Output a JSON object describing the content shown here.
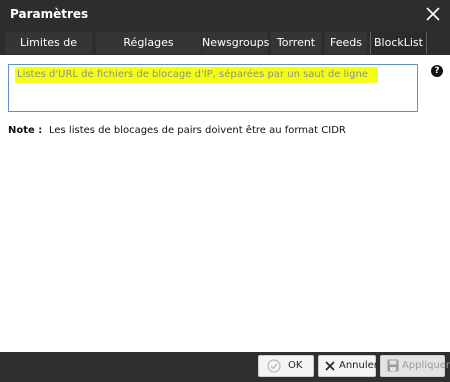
{
  "window": {
    "title": "Paramètres"
  },
  "tabs": [
    {
      "label": "Limites de vitesse"
    },
    {
      "label": "Réglages généraux"
    },
    {
      "label": "Newsgroups"
    },
    {
      "label": "Torrent"
    },
    {
      "label": "Feeds"
    },
    {
      "label": "BlockList"
    }
  ],
  "active_tab": "BlockList",
  "blocklist": {
    "placeholder": "Listes d'URL de fichiers de blocage d'IP, séparées par un saut de ligne",
    "help_icon": "question-circle-icon",
    "note_label": "Note :",
    "note_text": "Les listes de blocages de pairs doivent être au format CIDR"
  },
  "footer": {
    "ok_label": "OK",
    "cancel_label": "Annuler",
    "apply_label": "Appliquer"
  },
  "colors": {
    "title_bar": "#2d2d2d",
    "highlight": "#f3ff12",
    "input_border": "#5b8fd6"
  }
}
